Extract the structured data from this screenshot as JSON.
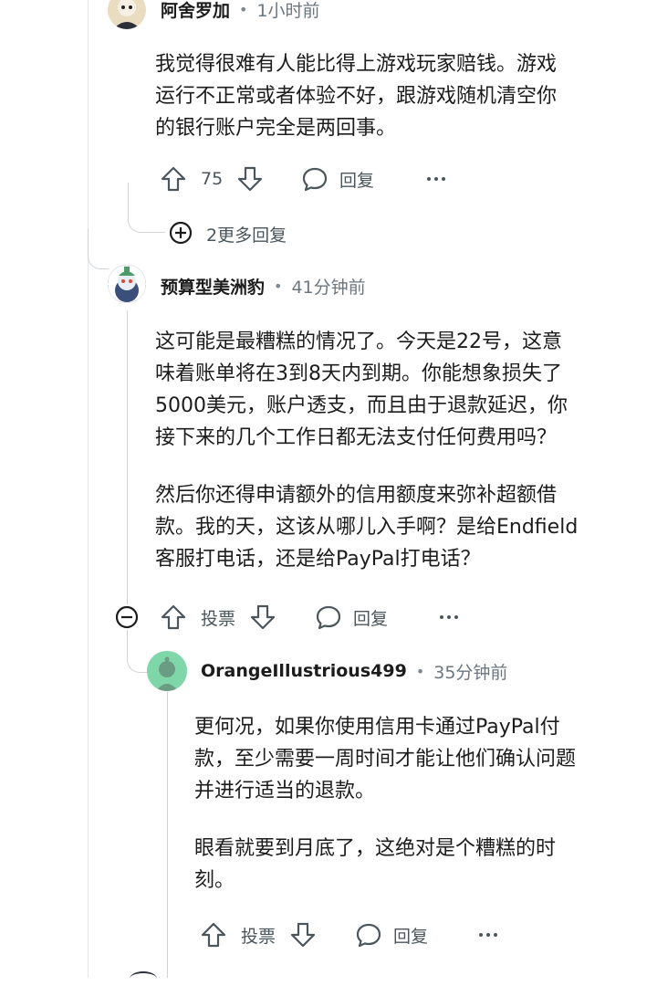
{
  "comment1": {
    "username": "阿舍罗加",
    "time": "1小时前",
    "body": [
      "我觉得很难有人能比得上游戏玩家赔钱。游戏",
      "运行不正常或者体验不好，跟游戏随机清空你",
      "的银行账户完全是两回事。"
    ],
    "vote_count": "75",
    "reply_label": "回复",
    "more_replies": "2更多回复"
  },
  "comment2": {
    "username": "预算型美洲豹",
    "time": "41分钟前",
    "body_p1": [
      "这可能是最糟糕的情况了。今天是22号，这意",
      "味着账单将在3到8天内到期。你能想象损失了",
      "5000美元，账户透支，而且由于退款延迟，你",
      "接下来的几个工作日都无法支付任何费用吗？"
    ],
    "body_p2": [
      "然后你还得申请额外的信用额度来弥补超额借",
      "款。我的天，这该从哪儿入手啊？是给Endfield",
      "客服打电话，还是给PayPal打电话？"
    ],
    "vote_label": "投票",
    "reply_label": "回复"
  },
  "comment3": {
    "username": "OrangeIllustrious499",
    "time": "35分钟前",
    "body_p1": [
      "更何况，如果你使用信用卡通过PayPal付",
      "款，至少需要一周时间才能让他们确认问题",
      "并进行适当的退款。"
    ],
    "body_p2": [
      "眼看就要到月底了，这绝对是个糟糕的时",
      "刻。"
    ],
    "vote_label": "投票",
    "reply_label": "回复"
  },
  "colors": {
    "avatar_green": "#7fd6a8",
    "avatar_blue": "#3b4f7a",
    "thread_line": "#d0d4d7"
  },
  "icons": [
    "upvote-icon",
    "downvote-icon",
    "comment-bubble-icon",
    "more-options-icon",
    "expand-plus-icon",
    "collapse-minus-icon"
  ]
}
